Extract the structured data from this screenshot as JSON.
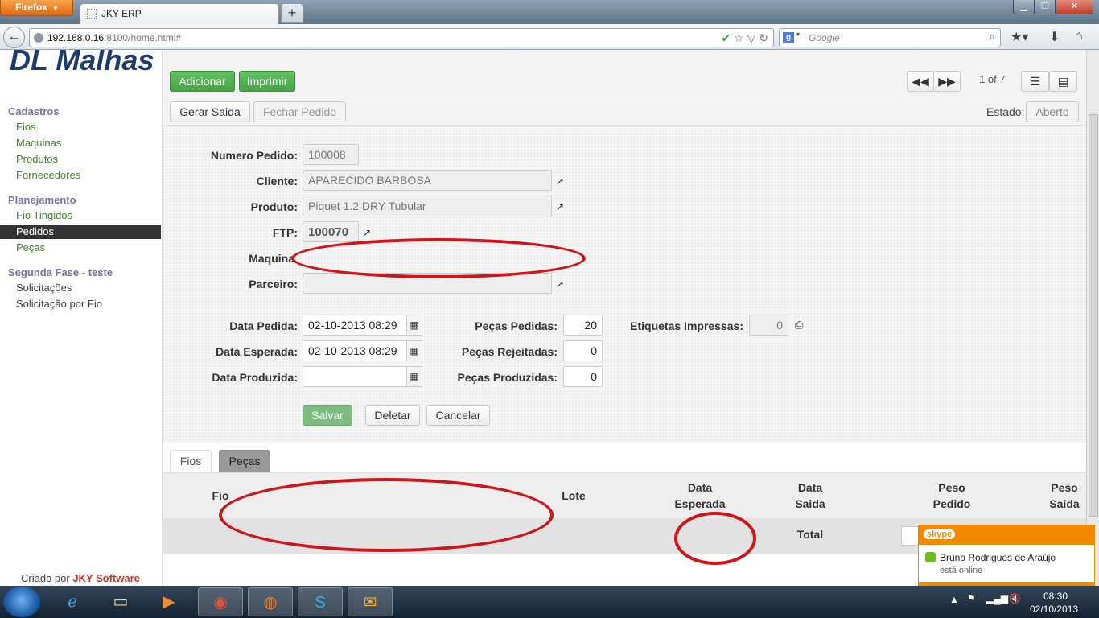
{
  "browser": {
    "menu_label": "Firefox",
    "tab_title": "JKY ERP",
    "new_tab": "+",
    "url_host": "192.168.0.16",
    "url_rest": ":8100/home.html#",
    "search_placeholder": "Google",
    "search_engine_letter": "g"
  },
  "sidebar": {
    "logo": "DL Malhas",
    "sections": [
      {
        "title": "Cadastros",
        "items": [
          "Fios",
          "Maquinas",
          "Produtos",
          "Fornecedores"
        ]
      },
      {
        "title": "Planejamento",
        "items": [
          "Fio Tingidos",
          "Pedidos",
          "Peças"
        ]
      },
      {
        "title": "Segunda Fase - teste",
        "items": [
          "Solicitações",
          "Solicitação por Fio"
        ]
      }
    ],
    "active_item": "Pedidos",
    "credit_prefix": "Criado por",
    "credit_brand": "JKY Software"
  },
  "toolbar": {
    "add_label": "Adicionar",
    "print_label": "Imprimir",
    "pager": "1 of 7",
    "generate_label": "Gerar Saida",
    "close_order_label": "Fechar Pedido",
    "status_label": "Estado:",
    "status_value": "Aberto"
  },
  "form": {
    "numero_label": "Numero Pedido:",
    "numero_value": "100008",
    "cliente_label": "Cliente:",
    "cliente_value": "APARECIDO BARBOSA",
    "produto_label": "Produto:",
    "produto_value": "Piquet 1.2 DRY Tubular",
    "ftp_label": "FTP:",
    "ftp_value": "100070",
    "maquina_label": "Maquina",
    "parceiro_label": "Parceiro:",
    "data_pedida_label": "Data Pedida:",
    "data_pedida_value": "02-10-2013 08:29",
    "data_esperada_label": "Data Esperada:",
    "data_esperada_value": "02-10-2013 08:29",
    "data_produzida_label": "Data Produzida:",
    "data_produzida_value": "",
    "pecas_pedidas_label": "Peças Pedidas:",
    "pecas_pedidas_value": "20",
    "pecas_rejeitadas_label": "Peças Rejeitadas:",
    "pecas_rejeitadas_value": "0",
    "pecas_produzidas_label": "Peças Produzidas:",
    "pecas_produzidas_value": "0",
    "etiquetas_label": "Etiquetas Impressas:",
    "etiquetas_value": "0",
    "save_label": "Salvar",
    "delete_label": "Deletar",
    "cancel_label": "Cancelar"
  },
  "tabs": [
    "Fios",
    "Peças"
  ],
  "grid": {
    "headers": [
      "Fio",
      "Lote",
      "Data Esperada",
      "Data Saida",
      "Peso Pedido",
      "Peso Saida"
    ],
    "total_label": "Total"
  },
  "skype": {
    "brand": "skype",
    "contact": "Bruno Rodrigues de Araújo",
    "status": "está online"
  },
  "taskbar": {
    "time": "08:30",
    "date": "02/10/2013"
  },
  "colors": {
    "green_button": "#5cb85c",
    "link_green": "#3d8a23",
    "section_purple": "#7373a5",
    "annotation_red": "#d0141a",
    "skype_orange": "#f28a00"
  }
}
